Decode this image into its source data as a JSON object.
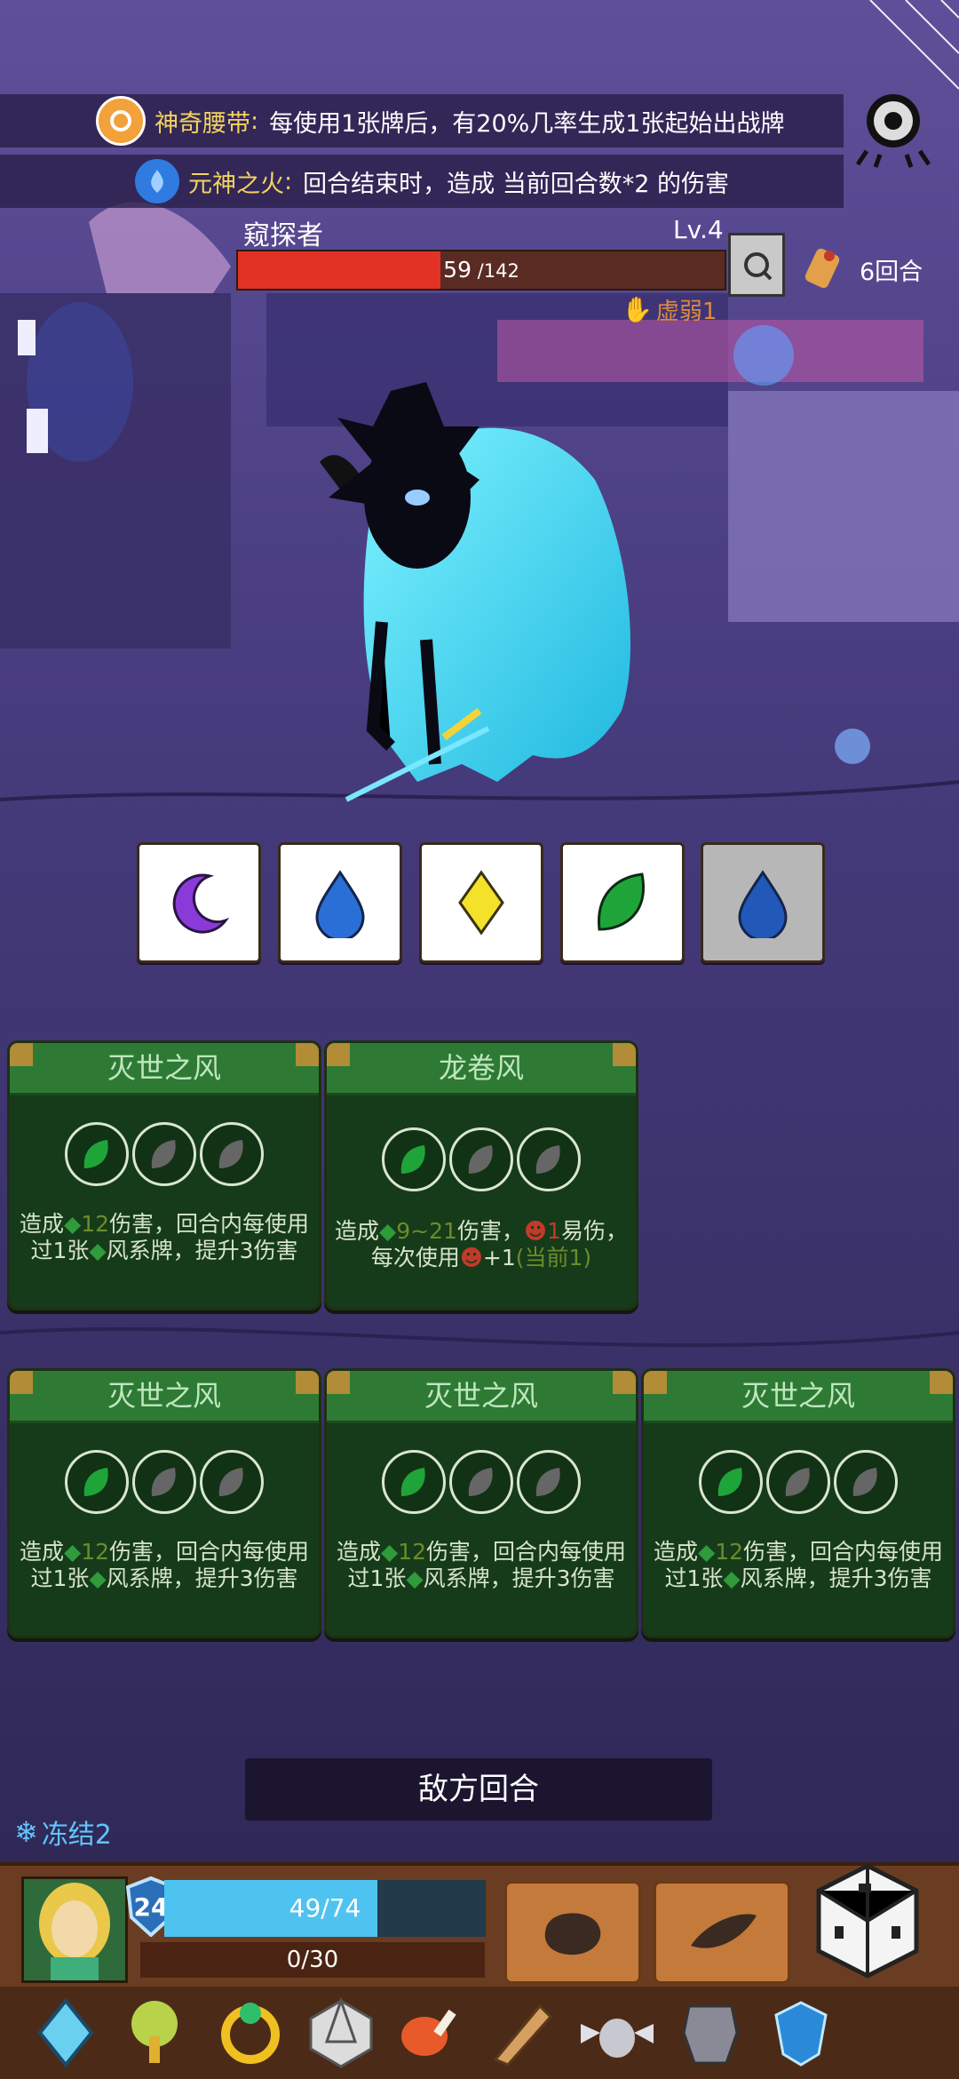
{
  "relics": [
    {
      "name": "神奇腰带",
      "sep": ":",
      "desc": "每使用1张牌后，有20%几率生成1张起始出战牌",
      "icon": "belt-icon",
      "color": "#f3a13a"
    },
    {
      "name": "元神之火",
      "sep": ":",
      "desc": "回合结束时，造成 当前回合数*2 的伤害",
      "icon": "blue-flame-icon",
      "color": "#2f7be0"
    }
  ],
  "enemy": {
    "name": "窥探者",
    "level": "Lv.4",
    "hp_current": "59",
    "hp_max": " /142",
    "hp_fraction": 0.4155,
    "status": "虚弱1",
    "status_icon": "weak-hand-icon"
  },
  "turn": {
    "label": "6回合",
    "icon": "scroll-icon"
  },
  "elements": [
    {
      "icon": "moon-icon",
      "color": "#8a3ad8",
      "dim": false
    },
    {
      "icon": "water-drop-icon",
      "color": "#2a6fd6",
      "dim": false
    },
    {
      "icon": "diamond-icon",
      "color": "#f3e12a",
      "dim": false
    },
    {
      "icon": "leaf-icon",
      "color": "#1fa43a",
      "dim": false
    },
    {
      "icon": "water-drop-icon",
      "color": "#2259b8",
      "dim": true
    }
  ],
  "cards": [
    {
      "title": "灭世之风",
      "desc_a": "造成",
      "val": "12",
      "desc_b": "伤害，回合内每使用过1张",
      "desc_c": "风系牌，提升3伤害"
    },
    {
      "title": "龙卷风",
      "desc_a": "造成",
      "val": "9~21",
      "desc_b": "伤害，",
      "vuln": "1",
      "desc_c": "易伤，每次使用",
      "plus": "+1",
      "current": "(当前1)"
    },
    {
      "title": "灭世之风",
      "desc_a": "造成",
      "val": "12",
      "desc_b": "伤害，回合内每使用过1张",
      "desc_c": "风系牌，提升3伤害"
    },
    {
      "title": "灭世之风",
      "desc_a": "造成",
      "val": "12",
      "desc_b": "伤害，回合内每使用过1张",
      "desc_c": "风系牌，提升3伤害"
    },
    {
      "title": "灭世之风",
      "desc_a": "造成",
      "val": "12",
      "desc_b": "伤害，回合内每使用过1张",
      "desc_c": "风系牌，提升3伤害"
    }
  ],
  "enemy_turn_label": "敌方回合",
  "player": {
    "freeze_label": "冻结2",
    "shield": "24",
    "hp_text": "49/74",
    "hp_fraction": 0.6622,
    "energy_text": "0/30"
  },
  "colors": {
    "hp_red": "#e23226",
    "player_hp": "#4fc3f0",
    "card_green": "#2e7a34",
    "gold": "#f4d35e"
  },
  "relic_bar": [
    "crystal-icon",
    "golden-tree-icon",
    "gold-ring-icon",
    "d20-dice-icon",
    "meat-icon",
    "horn-icon",
    "winged-cup-icon",
    "armor-icon",
    "blue-gem-icon"
  ]
}
